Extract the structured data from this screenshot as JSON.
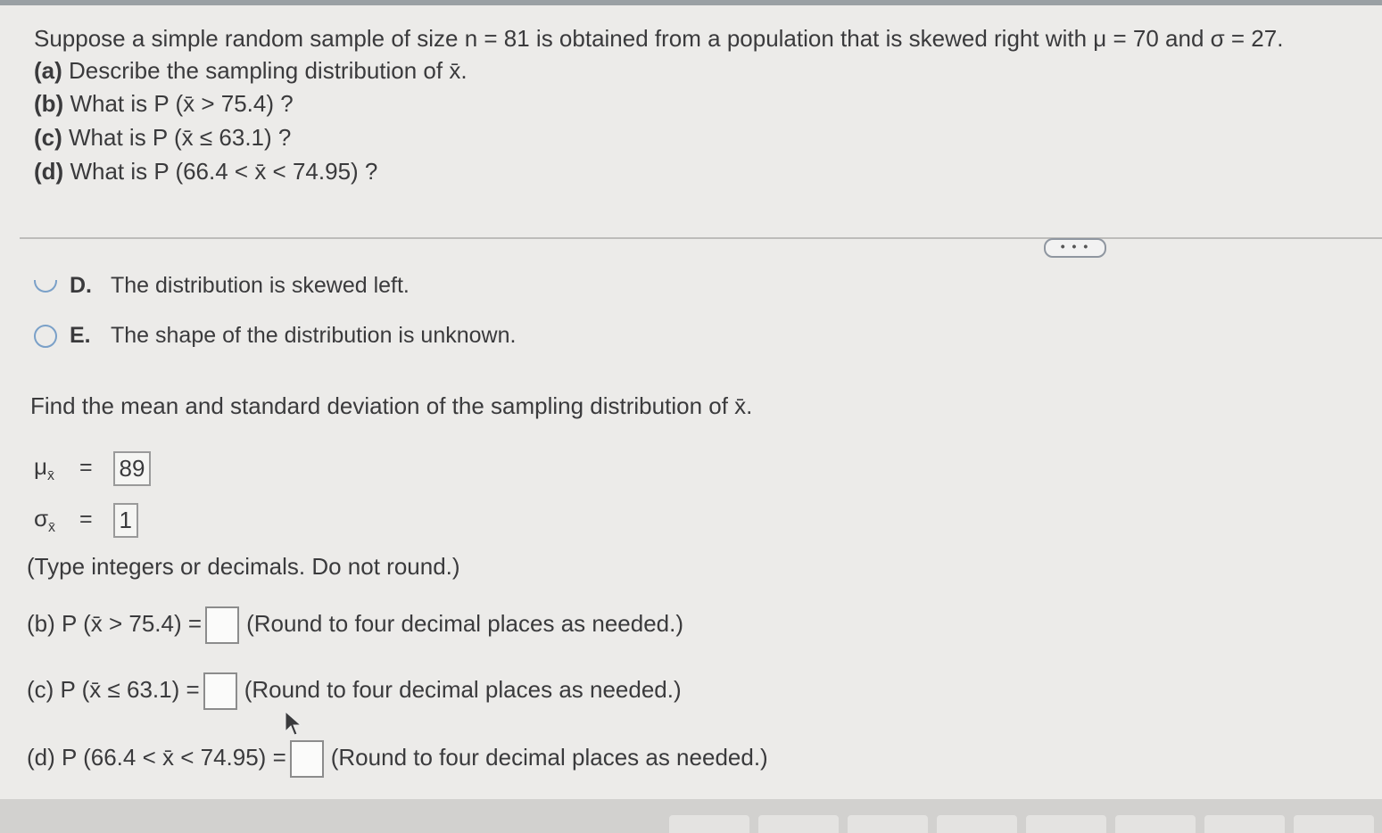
{
  "question": {
    "intro": "Suppose a simple random sample of size n = 81 is obtained from a population that is skewed right with μ = 70 and σ = 27.",
    "parts": [
      {
        "label": "(a)",
        "text": "Describe the sampling distribution of x̄."
      },
      {
        "label": "(b)",
        "text": "What is P (x̄ > 75.4) ?"
      },
      {
        "label": "(c)",
        "text": "What is P (x̄ ≤ 63.1) ?"
      },
      {
        "label": "(d)",
        "text": "What is P (66.4 < x̄ < 74.95) ?"
      }
    ]
  },
  "more_button": "• • •",
  "options": [
    {
      "letter": "D.",
      "text": "The distribution is skewed left."
    },
    {
      "letter": "E.",
      "text": "The shape of the distribution is unknown."
    }
  ],
  "find_text": "Find the mean and standard deviation of the sampling distribution of x̄.",
  "mean": {
    "symbol": "μ",
    "sub": "x̄",
    "eq": "=",
    "value": "89"
  },
  "sd": {
    "symbol": "σ",
    "sub": "x̄",
    "eq": "=",
    "value": "1"
  },
  "type_note": "(Type integers or decimals. Do not round.)",
  "answers": [
    {
      "label": "(b) P (x̄ > 75.4) =",
      "hint": "(Round to four decimal places as needed.)"
    },
    {
      "label": "(c) P (x̄ ≤ 63.1) =",
      "hint": "(Round to four decimal places as needed.)"
    },
    {
      "label": "(d) P (66.4 < x̄ < 74.95) =",
      "hint": "(Round to four decimal places as needed.)"
    }
  ]
}
